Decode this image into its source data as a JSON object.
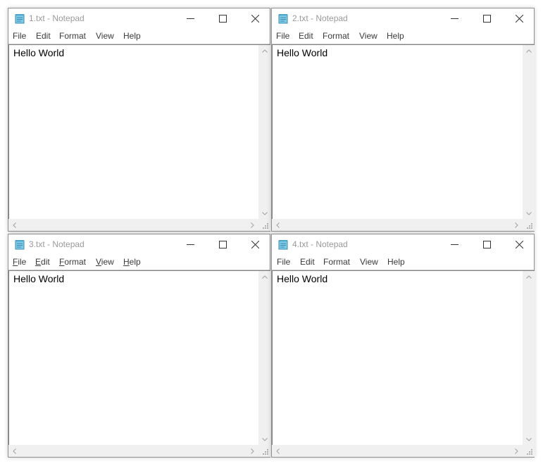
{
  "windows": [
    {
      "title": "1.txt - Notepad",
      "menu": [
        "File",
        "Edit",
        "Format",
        "View",
        "Help"
      ],
      "content": "Hello World",
      "menu_underlined": false
    },
    {
      "title": "2.txt - Notepad",
      "menu": [
        "File",
        "Edit",
        "Format",
        "View",
        "Help"
      ],
      "content": "Hello World",
      "menu_underlined": false
    },
    {
      "title": "3.txt - Notepad",
      "menu": [
        "File",
        "Edit",
        "Format",
        "View",
        "Help"
      ],
      "content": "Hello World",
      "menu_underlined": true
    },
    {
      "title": "4.txt - Notepad",
      "menu": [
        "File",
        "Edit",
        "Format",
        "View",
        "Help"
      ],
      "content": "Hello World",
      "menu_underlined": false
    }
  ],
  "icons": {
    "app": "notepad-icon",
    "minimize": "minimize-icon",
    "maximize": "maximize-icon",
    "close": "close-icon"
  },
  "colors": {
    "title_text": "#9a9a9a",
    "menu_text": "#3a3a3a",
    "window_border": "#8f8f8f",
    "scrollbar": "#f0f0f0"
  }
}
